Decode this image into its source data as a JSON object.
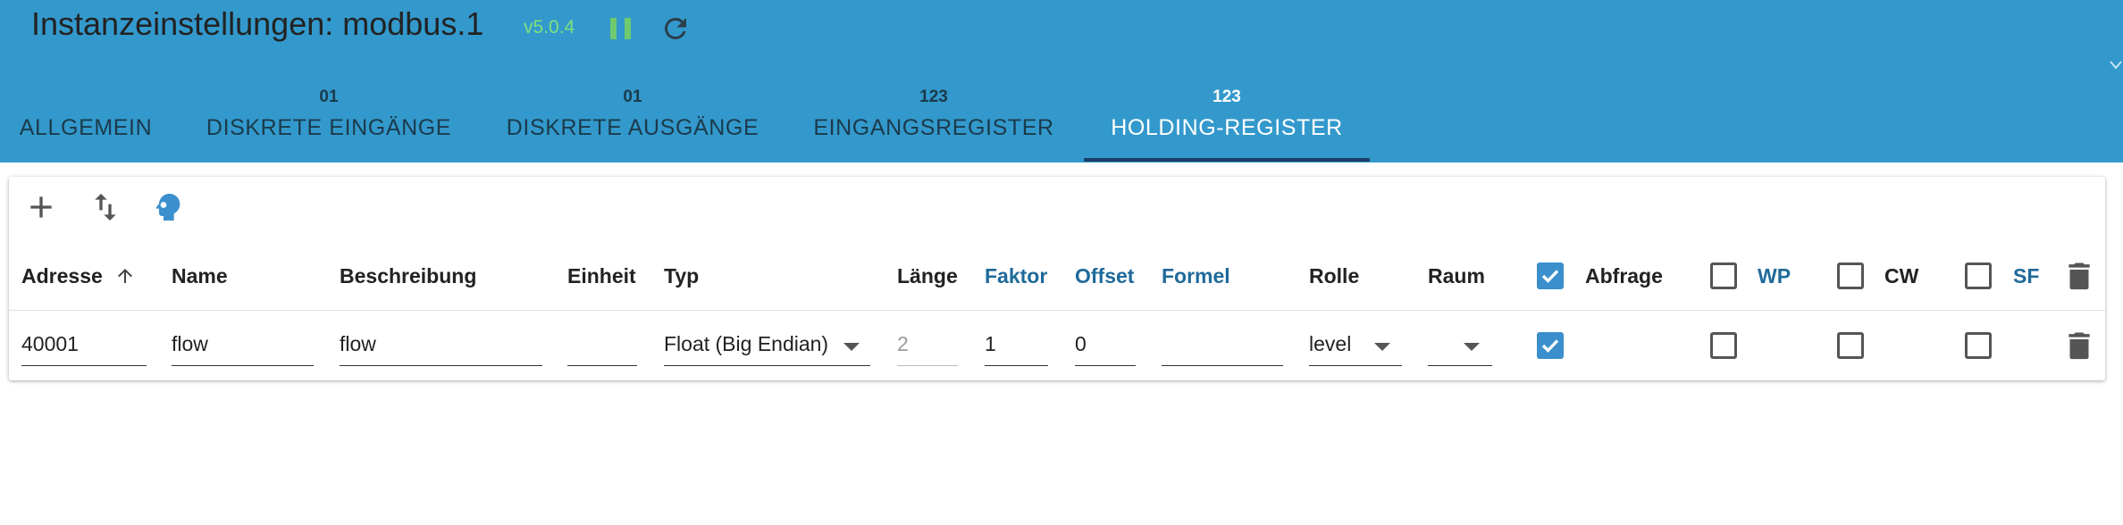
{
  "colors": {
    "header_bg": "#3399cc",
    "accent": "#3a8fcc",
    "version_text": "#7fe07f",
    "tab_indicator": "#1a3f6a"
  },
  "header": {
    "title": "Instanzeinstellungen: modbus.1",
    "version": "v5.0.4",
    "pause_icon": "pause-icon",
    "reload_icon": "reload-icon"
  },
  "tabs": [
    {
      "number": "",
      "label": "ALLGEMEIN",
      "active": false
    },
    {
      "number": "01",
      "label": "DISKRETE EINGÄNGE",
      "active": false
    },
    {
      "number": "01",
      "label": "DISKRETE AUSGÄNGE",
      "active": false
    },
    {
      "number": "123",
      "label": "EINGANGSREGISTER",
      "active": false
    },
    {
      "number": "123",
      "label": "HOLDING-REGISTER",
      "active": true
    }
  ],
  "toolbar": {
    "icons": [
      "add-icon",
      "import-export-icon",
      "head-icon"
    ]
  },
  "table": {
    "headers": {
      "address": "Adresse",
      "name": "Name",
      "description": "Beschreibung",
      "unit": "Einheit",
      "type": "Typ",
      "length": "Länge",
      "factor": "Faktor",
      "offset": "Offset",
      "formula": "Formel",
      "role": "Rolle",
      "room": "Raum",
      "poll": "Abfrage",
      "wp": "WP",
      "cw": "CW",
      "sf": "SF"
    },
    "header_checkboxes": {
      "poll": true,
      "wp": false,
      "cw": false,
      "sf": false
    },
    "sort_column": "Adresse",
    "rows": [
      {
        "address": "40001",
        "name": "flow",
        "description": "flow",
        "unit": "",
        "type": "Float (Big Endian)",
        "length": "2",
        "factor": "1",
        "offset": "0",
        "formula": "",
        "role": "level",
        "room": "",
        "poll": true,
        "wp": false,
        "cw": false,
        "sf": false
      }
    ]
  }
}
